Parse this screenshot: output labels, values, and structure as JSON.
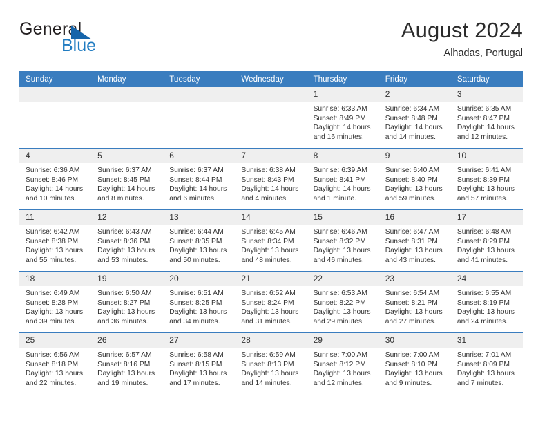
{
  "brand": {
    "name_part1": "General",
    "name_part2": "Blue",
    "flag_icon": "blue-triangle-flag-icon",
    "color_dark": "#231f20",
    "color_blue": "#1f7bc1"
  },
  "header": {
    "title": "August 2024",
    "subtitle": "Alhadas, Portugal"
  },
  "theme": {
    "header_blue": "#3a7dbf",
    "row_separator": "#3a7dbf",
    "daynum_band": "#efefef",
    "text": "#333333"
  },
  "calendar": {
    "weekday_headers": [
      "Sunday",
      "Monday",
      "Tuesday",
      "Wednesday",
      "Thursday",
      "Friday",
      "Saturday"
    ],
    "weeks": [
      [
        {
          "day": "",
          "sunrise": "",
          "sunset": "",
          "daylight_line1": "",
          "daylight_line2": ""
        },
        {
          "day": "",
          "sunrise": "",
          "sunset": "",
          "daylight_line1": "",
          "daylight_line2": ""
        },
        {
          "day": "",
          "sunrise": "",
          "sunset": "",
          "daylight_line1": "",
          "daylight_line2": ""
        },
        {
          "day": "",
          "sunrise": "",
          "sunset": "",
          "daylight_line1": "",
          "daylight_line2": ""
        },
        {
          "day": "1",
          "sunrise": "Sunrise: 6:33 AM",
          "sunset": "Sunset: 8:49 PM",
          "daylight_line1": "Daylight: 14 hours",
          "daylight_line2": "and 16 minutes."
        },
        {
          "day": "2",
          "sunrise": "Sunrise: 6:34 AM",
          "sunset": "Sunset: 8:48 PM",
          "daylight_line1": "Daylight: 14 hours",
          "daylight_line2": "and 14 minutes."
        },
        {
          "day": "3",
          "sunrise": "Sunrise: 6:35 AM",
          "sunset": "Sunset: 8:47 PM",
          "daylight_line1": "Daylight: 14 hours",
          "daylight_line2": "and 12 minutes."
        }
      ],
      [
        {
          "day": "4",
          "sunrise": "Sunrise: 6:36 AM",
          "sunset": "Sunset: 8:46 PM",
          "daylight_line1": "Daylight: 14 hours",
          "daylight_line2": "and 10 minutes."
        },
        {
          "day": "5",
          "sunrise": "Sunrise: 6:37 AM",
          "sunset": "Sunset: 8:45 PM",
          "daylight_line1": "Daylight: 14 hours",
          "daylight_line2": "and 8 minutes."
        },
        {
          "day": "6",
          "sunrise": "Sunrise: 6:37 AM",
          "sunset": "Sunset: 8:44 PM",
          "daylight_line1": "Daylight: 14 hours",
          "daylight_line2": "and 6 minutes."
        },
        {
          "day": "7",
          "sunrise": "Sunrise: 6:38 AM",
          "sunset": "Sunset: 8:43 PM",
          "daylight_line1": "Daylight: 14 hours",
          "daylight_line2": "and 4 minutes."
        },
        {
          "day": "8",
          "sunrise": "Sunrise: 6:39 AM",
          "sunset": "Sunset: 8:41 PM",
          "daylight_line1": "Daylight: 14 hours",
          "daylight_line2": "and 1 minute."
        },
        {
          "day": "9",
          "sunrise": "Sunrise: 6:40 AM",
          "sunset": "Sunset: 8:40 PM",
          "daylight_line1": "Daylight: 13 hours",
          "daylight_line2": "and 59 minutes."
        },
        {
          "day": "10",
          "sunrise": "Sunrise: 6:41 AM",
          "sunset": "Sunset: 8:39 PM",
          "daylight_line1": "Daylight: 13 hours",
          "daylight_line2": "and 57 minutes."
        }
      ],
      [
        {
          "day": "11",
          "sunrise": "Sunrise: 6:42 AM",
          "sunset": "Sunset: 8:38 PM",
          "daylight_line1": "Daylight: 13 hours",
          "daylight_line2": "and 55 minutes."
        },
        {
          "day": "12",
          "sunrise": "Sunrise: 6:43 AM",
          "sunset": "Sunset: 8:36 PM",
          "daylight_line1": "Daylight: 13 hours",
          "daylight_line2": "and 53 minutes."
        },
        {
          "day": "13",
          "sunrise": "Sunrise: 6:44 AM",
          "sunset": "Sunset: 8:35 PM",
          "daylight_line1": "Daylight: 13 hours",
          "daylight_line2": "and 50 minutes."
        },
        {
          "day": "14",
          "sunrise": "Sunrise: 6:45 AM",
          "sunset": "Sunset: 8:34 PM",
          "daylight_line1": "Daylight: 13 hours",
          "daylight_line2": "and 48 minutes."
        },
        {
          "day": "15",
          "sunrise": "Sunrise: 6:46 AM",
          "sunset": "Sunset: 8:32 PM",
          "daylight_line1": "Daylight: 13 hours",
          "daylight_line2": "and 46 minutes."
        },
        {
          "day": "16",
          "sunrise": "Sunrise: 6:47 AM",
          "sunset": "Sunset: 8:31 PM",
          "daylight_line1": "Daylight: 13 hours",
          "daylight_line2": "and 43 minutes."
        },
        {
          "day": "17",
          "sunrise": "Sunrise: 6:48 AM",
          "sunset": "Sunset: 8:29 PM",
          "daylight_line1": "Daylight: 13 hours",
          "daylight_line2": "and 41 minutes."
        }
      ],
      [
        {
          "day": "18",
          "sunrise": "Sunrise: 6:49 AM",
          "sunset": "Sunset: 8:28 PM",
          "daylight_line1": "Daylight: 13 hours",
          "daylight_line2": "and 39 minutes."
        },
        {
          "day": "19",
          "sunrise": "Sunrise: 6:50 AM",
          "sunset": "Sunset: 8:27 PM",
          "daylight_line1": "Daylight: 13 hours",
          "daylight_line2": "and 36 minutes."
        },
        {
          "day": "20",
          "sunrise": "Sunrise: 6:51 AM",
          "sunset": "Sunset: 8:25 PM",
          "daylight_line1": "Daylight: 13 hours",
          "daylight_line2": "and 34 minutes."
        },
        {
          "day": "21",
          "sunrise": "Sunrise: 6:52 AM",
          "sunset": "Sunset: 8:24 PM",
          "daylight_line1": "Daylight: 13 hours",
          "daylight_line2": "and 31 minutes."
        },
        {
          "day": "22",
          "sunrise": "Sunrise: 6:53 AM",
          "sunset": "Sunset: 8:22 PM",
          "daylight_line1": "Daylight: 13 hours",
          "daylight_line2": "and 29 minutes."
        },
        {
          "day": "23",
          "sunrise": "Sunrise: 6:54 AM",
          "sunset": "Sunset: 8:21 PM",
          "daylight_line1": "Daylight: 13 hours",
          "daylight_line2": "and 27 minutes."
        },
        {
          "day": "24",
          "sunrise": "Sunrise: 6:55 AM",
          "sunset": "Sunset: 8:19 PM",
          "daylight_line1": "Daylight: 13 hours",
          "daylight_line2": "and 24 minutes."
        }
      ],
      [
        {
          "day": "25",
          "sunrise": "Sunrise: 6:56 AM",
          "sunset": "Sunset: 8:18 PM",
          "daylight_line1": "Daylight: 13 hours",
          "daylight_line2": "and 22 minutes."
        },
        {
          "day": "26",
          "sunrise": "Sunrise: 6:57 AM",
          "sunset": "Sunset: 8:16 PM",
          "daylight_line1": "Daylight: 13 hours",
          "daylight_line2": "and 19 minutes."
        },
        {
          "day": "27",
          "sunrise": "Sunrise: 6:58 AM",
          "sunset": "Sunset: 8:15 PM",
          "daylight_line1": "Daylight: 13 hours",
          "daylight_line2": "and 17 minutes."
        },
        {
          "day": "28",
          "sunrise": "Sunrise: 6:59 AM",
          "sunset": "Sunset: 8:13 PM",
          "daylight_line1": "Daylight: 13 hours",
          "daylight_line2": "and 14 minutes."
        },
        {
          "day": "29",
          "sunrise": "Sunrise: 7:00 AM",
          "sunset": "Sunset: 8:12 PM",
          "daylight_line1": "Daylight: 13 hours",
          "daylight_line2": "and 12 minutes."
        },
        {
          "day": "30",
          "sunrise": "Sunrise: 7:00 AM",
          "sunset": "Sunset: 8:10 PM",
          "daylight_line1": "Daylight: 13 hours",
          "daylight_line2": "and 9 minutes."
        },
        {
          "day": "31",
          "sunrise": "Sunrise: 7:01 AM",
          "sunset": "Sunset: 8:09 PM",
          "daylight_line1": "Daylight: 13 hours",
          "daylight_line2": "and 7 minutes."
        }
      ]
    ]
  }
}
